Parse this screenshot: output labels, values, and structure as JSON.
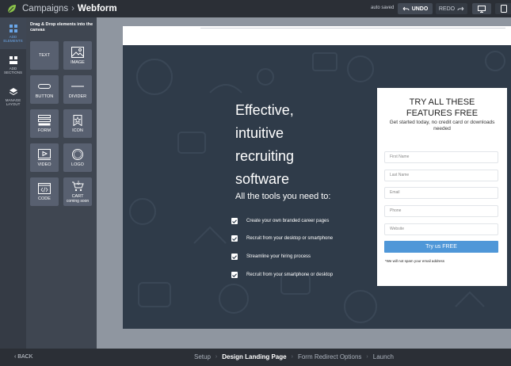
{
  "header": {
    "breadcrumb_root": "Campaigns",
    "breadcrumb_current": "Webform",
    "autosave": "auto saved",
    "undo_label": "UNDO",
    "redo_label": "REDO",
    "icons": {
      "logo": "leaf-logo-icon",
      "desktop": "desktop-preview-icon",
      "tablet": "tablet-preview-icon"
    }
  },
  "rail": {
    "items": [
      {
        "label": "ADD ELEMENTS",
        "icon": "grid-icon",
        "active": true
      },
      {
        "label": "ADD SECTIONS",
        "icon": "sections-icon",
        "active": false
      },
      {
        "label": "MANAGE LAYOUT",
        "icon": "layers-icon",
        "active": false
      }
    ]
  },
  "panel": {
    "title": "Drag & Drop elements into the canvas",
    "tiles": [
      {
        "label": "TEXT",
        "icon": "text-icon"
      },
      {
        "label": "IMAGE",
        "icon": "image-icon"
      },
      {
        "label": "BUTTON",
        "icon": "button-icon"
      },
      {
        "label": "DIVIDER",
        "icon": "divider-icon"
      },
      {
        "label": "FORM",
        "icon": "form-icon"
      },
      {
        "label": "ICON",
        "icon": "star-badge-icon"
      },
      {
        "label": "VIDEO",
        "icon": "video-icon"
      },
      {
        "label": "LOGO",
        "icon": "logo-icon"
      },
      {
        "label": "CODE",
        "icon": "code-icon"
      },
      {
        "label": "CART",
        "sub": "coming soon",
        "icon": "cart-icon"
      }
    ]
  },
  "hero": {
    "headline": [
      "Effective,",
      "intuitive",
      "recruiting",
      "software"
    ],
    "subhead": "All the tools you need to:",
    "features": [
      "Create your own branded career pages",
      "Recruit from your desktop or smartphone",
      "Streamline your hiring process",
      "Recruit from your smartphone or desktop"
    ]
  },
  "form_card": {
    "title_line1": "TRY ALL THESE",
    "title_line2": "FEATURES FREE",
    "subtitle": "Get started today, no credit card or downloads needed",
    "fields": [
      "First Name",
      "Last Name",
      "Email",
      "Phone",
      "Website"
    ],
    "submit_label": "Try us FREE",
    "note": "*We will not spam your email address"
  },
  "footer": {
    "back_label": "BACK",
    "steps": [
      "Setup",
      "Design Landing Page",
      "Form Redirect Options",
      "Launch"
    ],
    "current_step": "Design Landing Page"
  },
  "colors": {
    "accent": "#4f97d8",
    "active_rail": "#6aa6e8",
    "hero_bg": "#2f3b49"
  }
}
